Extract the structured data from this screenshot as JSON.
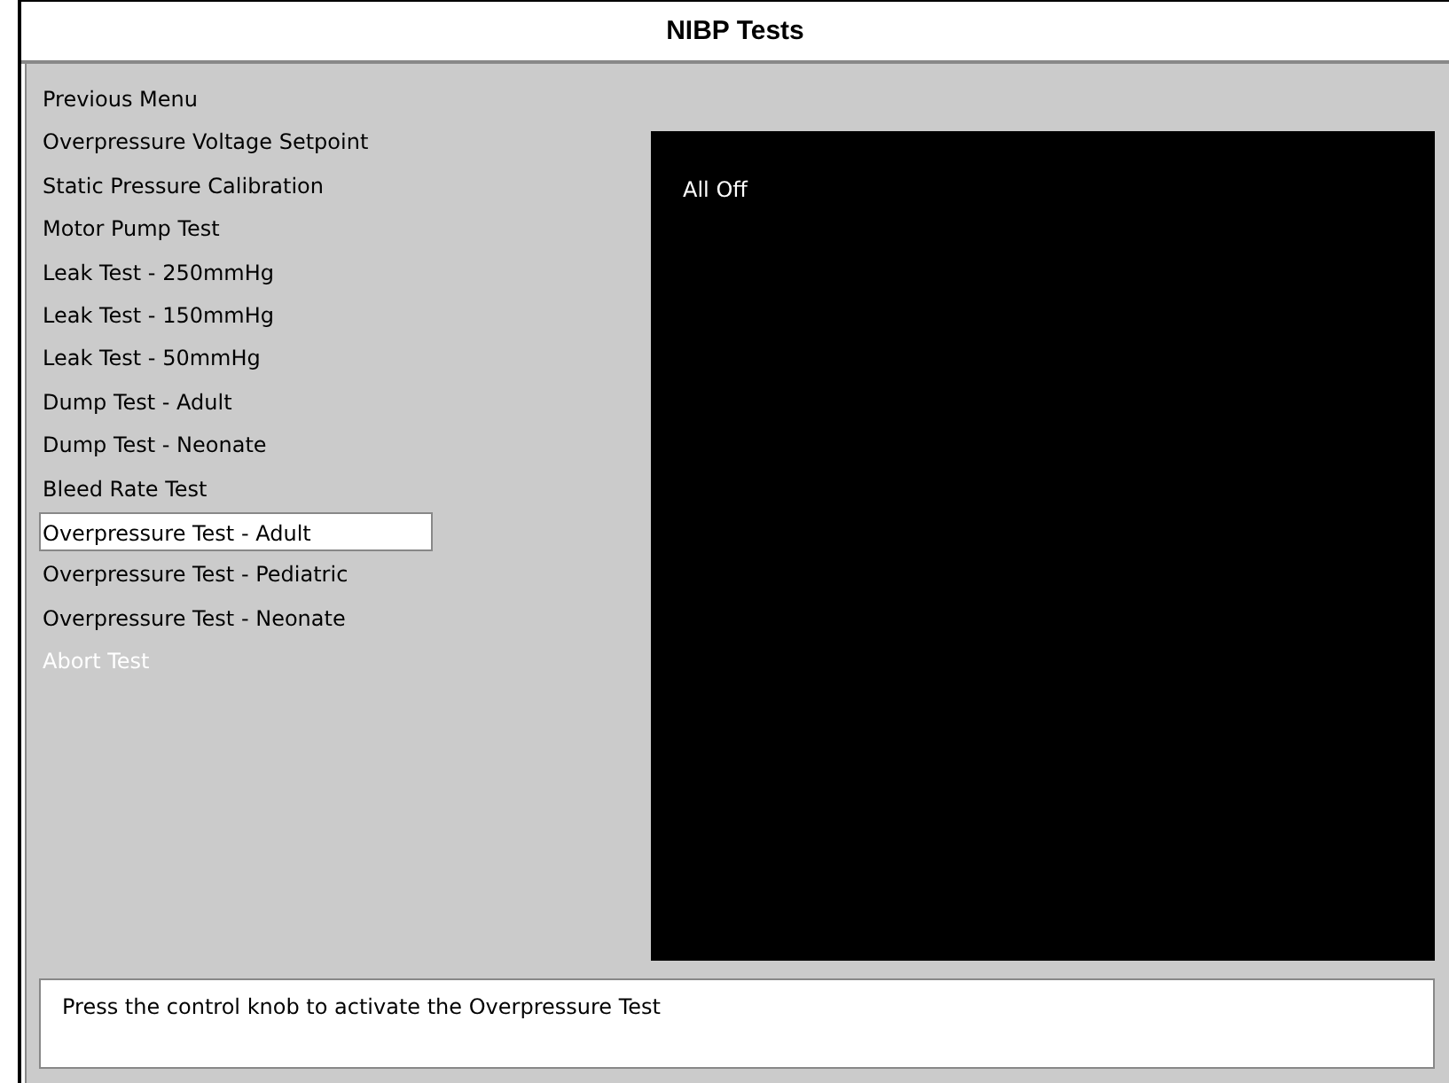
{
  "window": {
    "title": "NIBP Tests"
  },
  "menu": [
    {
      "label": "Previous Menu",
      "selected": false,
      "disabled": false
    },
    {
      "label": "Overpressure Voltage Setpoint",
      "selected": false,
      "disabled": false
    },
    {
      "label": "Static Pressure Calibration",
      "selected": false,
      "disabled": false
    },
    {
      "label": "Motor Pump Test",
      "selected": false,
      "disabled": false
    },
    {
      "label": "Leak Test - 250mmHg",
      "selected": false,
      "disabled": false
    },
    {
      "label": "Leak Test - 150mmHg",
      "selected": false,
      "disabled": false
    },
    {
      "label": "Leak Test - 50mmHg",
      "selected": false,
      "disabled": false
    },
    {
      "label": "Dump Test - Adult",
      "selected": false,
      "disabled": false
    },
    {
      "label": "Dump Test - Neonate",
      "selected": false,
      "disabled": false
    },
    {
      "label": "Bleed Rate Test",
      "selected": false,
      "disabled": false
    },
    {
      "label": "Overpressure Test - Adult",
      "selected": true,
      "disabled": false
    },
    {
      "label": "Overpressure Test - Pediatric",
      "selected": false,
      "disabled": false
    },
    {
      "label": "Overpressure Test - Neonate",
      "selected": false,
      "disabled": false
    },
    {
      "label": "Abort Test",
      "selected": false,
      "disabled": true
    }
  ],
  "display": {
    "status": "All Off"
  },
  "message": "Press the control knob to activate the Overpressure Test"
}
